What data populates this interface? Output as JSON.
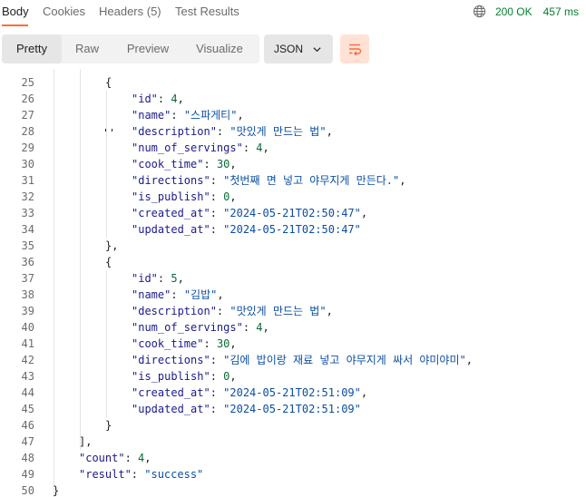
{
  "tabs": [
    {
      "label": "Body",
      "active": true
    },
    {
      "label": "Cookies",
      "active": false
    },
    {
      "label": "Headers (5)",
      "active": false
    },
    {
      "label": "Test Results",
      "active": false
    }
  ],
  "status": {
    "code": "200 OK",
    "time": "457 ms",
    "icon": "globe-icon"
  },
  "view_modes": [
    {
      "label": "Pretty",
      "active": true
    },
    {
      "label": "Raw",
      "active": false
    },
    {
      "label": "Preview",
      "active": false
    },
    {
      "label": "Visualize",
      "active": false
    }
  ],
  "format": {
    "selected": "JSON",
    "icon": "chevron-down-icon"
  },
  "wrap_icon": "wrap-lines-icon",
  "colors": {
    "accent": "#ff6c37",
    "status_ok": "#007f31",
    "key": "#1a1a8c",
    "string": "#0b4ea2",
    "number": "#0b6b3a"
  },
  "code_lines": [
    {
      "n": "25",
      "indent": 3,
      "parts": [
        {
          "t": "{",
          "c": "p"
        }
      ]
    },
    {
      "n": "26",
      "indent": 4,
      "parts": [
        {
          "t": "\"id\"",
          "c": "key"
        },
        {
          "t": ": ",
          "c": "p"
        },
        {
          "t": "4",
          "c": "num"
        },
        {
          "t": ",",
          "c": "p"
        }
      ]
    },
    {
      "n": "27",
      "indent": 4,
      "parts": [
        {
          "t": "\"name\"",
          "c": "key"
        },
        {
          "t": ": ",
          "c": "p"
        },
        {
          "t": "\"스파게티\"",
          "c": "str"
        },
        {
          "t": ",",
          "c": "p"
        }
      ]
    },
    {
      "n": "28",
      "indent": 4,
      "parts": [
        {
          "t": "\"description\"",
          "c": "key"
        },
        {
          "t": ": ",
          "c": "p"
        },
        {
          "t": "\"맛있게 만드는 법\"",
          "c": "str"
        },
        {
          "t": ",",
          "c": "p"
        }
      ]
    },
    {
      "n": "29",
      "indent": 4,
      "parts": [
        {
          "t": "\"num_of_servings\"",
          "c": "key"
        },
        {
          "t": ": ",
          "c": "p"
        },
        {
          "t": "4",
          "c": "num"
        },
        {
          "t": ",",
          "c": "p"
        }
      ]
    },
    {
      "n": "30",
      "indent": 4,
      "parts": [
        {
          "t": "\"cook_time\"",
          "c": "key"
        },
        {
          "t": ": ",
          "c": "p"
        },
        {
          "t": "30",
          "c": "num"
        },
        {
          "t": ",",
          "c": "p"
        }
      ]
    },
    {
      "n": "31",
      "indent": 4,
      "parts": [
        {
          "t": "\"directions\"",
          "c": "key"
        },
        {
          "t": ": ",
          "c": "p"
        },
        {
          "t": "\"첫번째 면 넣고 야무지게 만든다.\"",
          "c": "str"
        },
        {
          "t": ",",
          "c": "p"
        }
      ]
    },
    {
      "n": "32",
      "indent": 4,
      "parts": [
        {
          "t": "\"is_publish\"",
          "c": "key"
        },
        {
          "t": ": ",
          "c": "p"
        },
        {
          "t": "0",
          "c": "num"
        },
        {
          "t": ",",
          "c": "p"
        }
      ]
    },
    {
      "n": "33",
      "indent": 4,
      "parts": [
        {
          "t": "\"created_at\"",
          "c": "key"
        },
        {
          "t": ": ",
          "c": "p"
        },
        {
          "t": "\"2024-05-21T02:50:47\"",
          "c": "str"
        },
        {
          "t": ",",
          "c": "p"
        }
      ]
    },
    {
      "n": "34",
      "indent": 4,
      "parts": [
        {
          "t": "\"updated_at\"",
          "c": "key"
        },
        {
          "t": ": ",
          "c": "p"
        },
        {
          "t": "\"2024-05-21T02:50:47\"",
          "c": "str"
        }
      ]
    },
    {
      "n": "35",
      "indent": 3,
      "parts": [
        {
          "t": "},",
          "c": "p"
        }
      ]
    },
    {
      "n": "36",
      "indent": 3,
      "parts": [
        {
          "t": "{",
          "c": "p"
        }
      ]
    },
    {
      "n": "37",
      "indent": 4,
      "parts": [
        {
          "t": "\"id\"",
          "c": "key"
        },
        {
          "t": ": ",
          "c": "p"
        },
        {
          "t": "5",
          "c": "num"
        },
        {
          "t": ",",
          "c": "p"
        }
      ]
    },
    {
      "n": "38",
      "indent": 4,
      "parts": [
        {
          "t": "\"name\"",
          "c": "key"
        },
        {
          "t": ": ",
          "c": "p"
        },
        {
          "t": "\"김밥\"",
          "c": "str"
        },
        {
          "t": ",",
          "c": "p"
        }
      ]
    },
    {
      "n": "39",
      "indent": 4,
      "parts": [
        {
          "t": "\"description\"",
          "c": "key"
        },
        {
          "t": ": ",
          "c": "p"
        },
        {
          "t": "\"맛있게 만드는 법\"",
          "c": "str"
        },
        {
          "t": ",",
          "c": "p"
        }
      ]
    },
    {
      "n": "40",
      "indent": 4,
      "parts": [
        {
          "t": "\"num_of_servings\"",
          "c": "key"
        },
        {
          "t": ": ",
          "c": "p"
        },
        {
          "t": "4",
          "c": "num"
        },
        {
          "t": ",",
          "c": "p"
        }
      ]
    },
    {
      "n": "41",
      "indent": 4,
      "parts": [
        {
          "t": "\"cook_time\"",
          "c": "key"
        },
        {
          "t": ": ",
          "c": "p"
        },
        {
          "t": "30",
          "c": "num"
        },
        {
          "t": ",",
          "c": "p"
        }
      ]
    },
    {
      "n": "42",
      "indent": 4,
      "parts": [
        {
          "t": "\"directions\"",
          "c": "key"
        },
        {
          "t": ": ",
          "c": "p"
        },
        {
          "t": "\"김에 밥이랑 재료 넣고 야무지게 싸서 야미야미\"",
          "c": "str"
        },
        {
          "t": ",",
          "c": "p"
        }
      ]
    },
    {
      "n": "43",
      "indent": 4,
      "parts": [
        {
          "t": "\"is_publish\"",
          "c": "key"
        },
        {
          "t": ": ",
          "c": "p"
        },
        {
          "t": "0",
          "c": "num"
        },
        {
          "t": ",",
          "c": "p"
        }
      ]
    },
    {
      "n": "44",
      "indent": 4,
      "parts": [
        {
          "t": "\"created_at\"",
          "c": "key"
        },
        {
          "t": ": ",
          "c": "p"
        },
        {
          "t": "\"2024-05-21T02:51:09\"",
          "c": "str"
        },
        {
          "t": ",",
          "c": "p"
        }
      ]
    },
    {
      "n": "45",
      "indent": 4,
      "parts": [
        {
          "t": "\"updated_at\"",
          "c": "key"
        },
        {
          "t": ": ",
          "c": "p"
        },
        {
          "t": "\"2024-05-21T02:51:09\"",
          "c": "str"
        }
      ]
    },
    {
      "n": "46",
      "indent": 3,
      "parts": [
        {
          "t": "}",
          "c": "p"
        }
      ]
    },
    {
      "n": "47",
      "indent": 2,
      "parts": [
        {
          "t": "],",
          "c": "p"
        }
      ]
    },
    {
      "n": "48",
      "indent": 2,
      "parts": [
        {
          "t": "\"count\"",
          "c": "key"
        },
        {
          "t": ": ",
          "c": "p"
        },
        {
          "t": "4",
          "c": "num"
        },
        {
          "t": ",",
          "c": "p"
        }
      ]
    },
    {
      "n": "49",
      "indent": 2,
      "parts": [
        {
          "t": "\"result\"",
          "c": "key"
        },
        {
          "t": ": ",
          "c": "p"
        },
        {
          "t": "\"success\"",
          "c": "str"
        }
      ]
    },
    {
      "n": "50",
      "indent": 1,
      "parts": [
        {
          "t": "}",
          "c": "p"
        }
      ]
    }
  ]
}
